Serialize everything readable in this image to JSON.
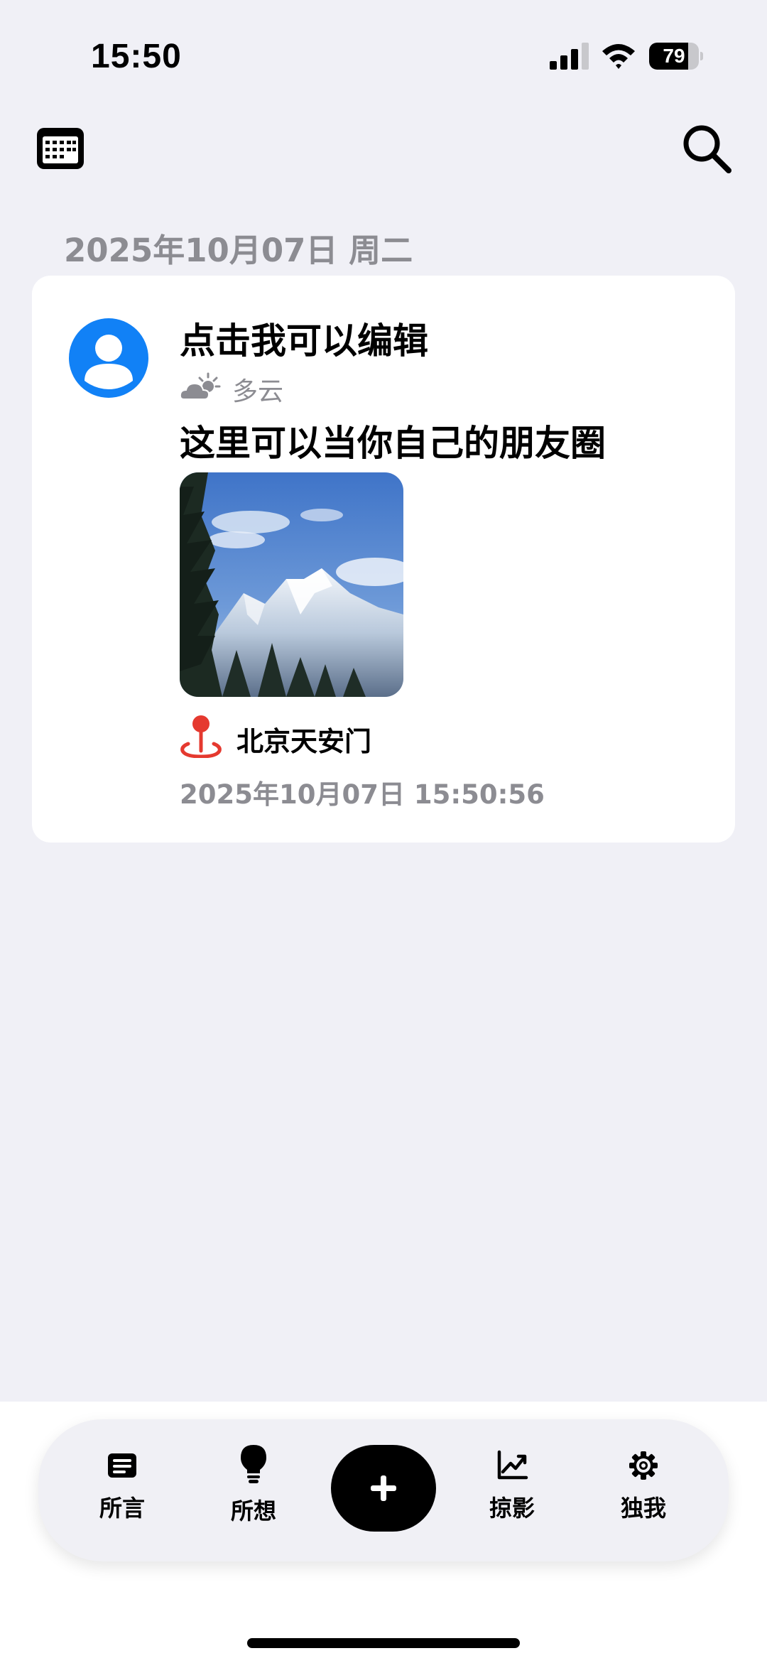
{
  "status_bar": {
    "time": "15:50",
    "battery_percent": 79,
    "battery_label": "79",
    "signal_bars": 3
  },
  "toolbar": {
    "calendar_icon": "calendar-icon",
    "search_icon": "search-icon"
  },
  "feed": {
    "date_header": "2025年10月07日 周二",
    "entries": [
      {
        "avatar_icon": "person-avatar-icon",
        "title": "点击我可以编辑",
        "weather_icon": "partly-cloudy-icon",
        "weather": "多云",
        "body": "这里可以当你自己的朋友圈",
        "photo": "snow-mountain-photo",
        "location_icon": "map-pin-icon",
        "location": "北京天安门",
        "timestamp": "2025年10月07日 15:50:56"
      }
    ]
  },
  "tab_bar": {
    "tabs": [
      {
        "label": "所言",
        "icon": "note-icon"
      },
      {
        "label": "所想",
        "icon": "lightbulb-icon"
      },
      {
        "label": "",
        "icon": "plus-icon"
      },
      {
        "label": "掠影",
        "icon": "chart-line-icon"
      },
      {
        "label": "独我",
        "icon": "gear-icon"
      }
    ]
  },
  "colors": {
    "background": "#f0f0f6",
    "accent_blue": "#1181f6",
    "location_red": "#e5392f",
    "secondary_text": "#8c8c92"
  }
}
